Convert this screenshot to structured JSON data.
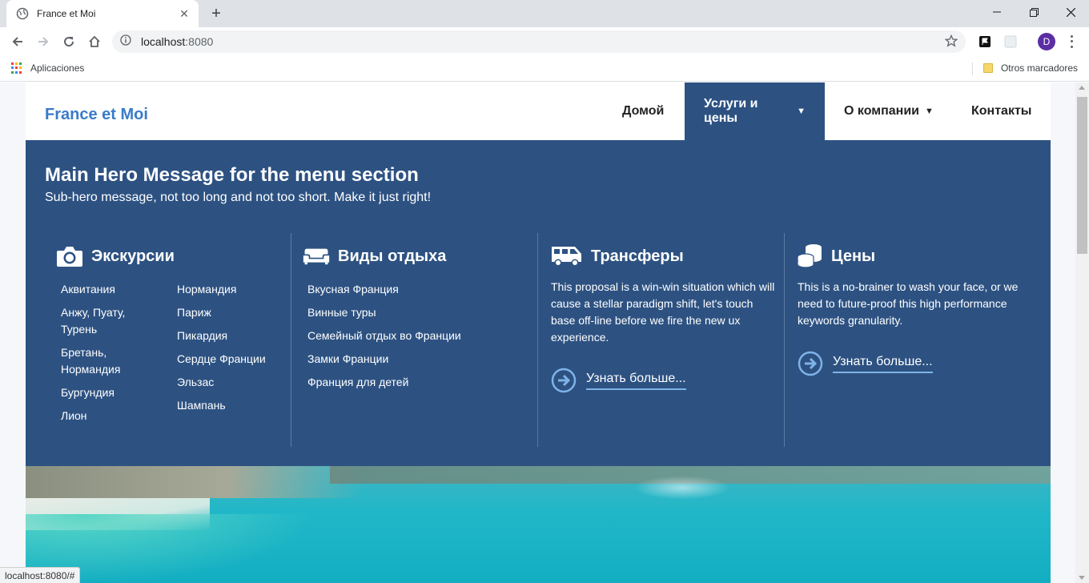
{
  "browser": {
    "tab_title": "France et Moi",
    "url_host": "localhost",
    "url_port": ":8080",
    "bookmark_apps": "Aplicaciones",
    "bookmark_other": "Otros marcadores",
    "profile_initial": "D",
    "status_url": "localhost:8080/#"
  },
  "site": {
    "brand": "France et Moi",
    "nav": {
      "home": "Домой",
      "services": "Услуги и цены",
      "company": "О компании",
      "contacts": "Контакты"
    },
    "caret": "▼",
    "hero": {
      "title": "Main Hero Message for the menu section",
      "subtitle": "Sub-hero message, not too long and not too short. Make it just right!"
    },
    "columns": {
      "excursions": {
        "title": "Экскурсии",
        "links_left": [
          "Аквитания",
          "Анжу, Пуату, Турень",
          "Бретань, Нормандия",
          "Бургундия",
          "Лион"
        ],
        "links_right": [
          "Нормандия",
          "Париж",
          "Пикардия",
          "Сердце Франции",
          "Эльзас",
          "Шампань"
        ]
      },
      "holidays": {
        "title": "Виды отдыха",
        "links": [
          "Вкусная Франция",
          "Винные туры",
          "Семейный отдых во Франции",
          "Замки Франции",
          "Франция для детей"
        ]
      },
      "transfers": {
        "title": "Трансферы",
        "text": "This proposal is a win-win situation which will cause a stellar paradigm shift, let's touch base off-line before we fire the new ux experience.",
        "cta": "Узнать больше..."
      },
      "prices": {
        "title": "Цены",
        "text": "This is a no-brainer to wash your face, or we need to future-proof this high performance keywords granularity.",
        "cta": "Узнать больше..."
      }
    }
  },
  "colors": {
    "brand": "#3a7bc8",
    "mega_bg": "#2d5282",
    "accent": "#7fb3e8"
  }
}
